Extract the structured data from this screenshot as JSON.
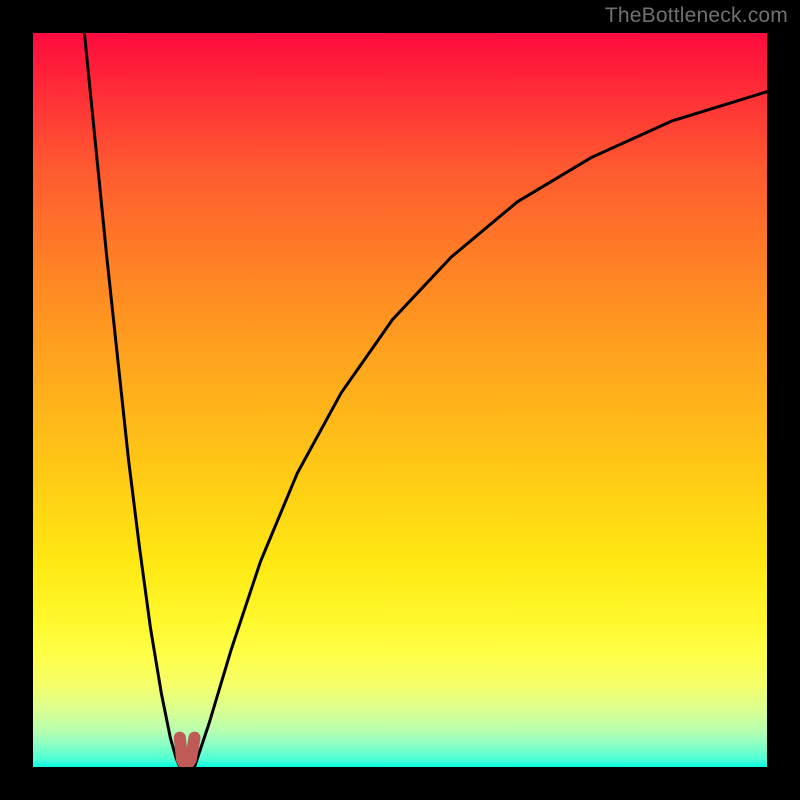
{
  "watermark": "TheBottleneck.com",
  "chart_data": {
    "type": "line",
    "title": "",
    "xlabel": "",
    "ylabel": "",
    "xlim": [
      0,
      1
    ],
    "ylim": [
      0,
      1
    ],
    "series": [
      {
        "name": "left-branch",
        "x": [
          0.07,
          0.085,
          0.1,
          0.115,
          0.13,
          0.145,
          0.16,
          0.175,
          0.187,
          0.195,
          0.2
        ],
        "y": [
          1.0,
          0.85,
          0.7,
          0.56,
          0.42,
          0.3,
          0.19,
          0.1,
          0.04,
          0.012,
          0.0
        ]
      },
      {
        "name": "right-branch",
        "x": [
          0.22,
          0.24,
          0.27,
          0.31,
          0.36,
          0.42,
          0.49,
          0.57,
          0.66,
          0.76,
          0.87,
          1.0
        ],
        "y": [
          0.0,
          0.06,
          0.16,
          0.28,
          0.4,
          0.51,
          0.61,
          0.695,
          0.77,
          0.83,
          0.88,
          0.92
        ]
      },
      {
        "name": "min-marker",
        "x": [
          0.2,
          0.203,
          0.208,
          0.215,
          0.22
        ],
        "y": [
          0.04,
          0.01,
          0.0,
          0.01,
          0.04
        ]
      }
    ],
    "gradient_stops": [
      {
        "pos": 0.0,
        "color": "#ff0b3e"
      },
      {
        "pos": 0.18,
        "color": "#ff5830"
      },
      {
        "pos": 0.46,
        "color": "#ffa81d"
      },
      {
        "pos": 0.72,
        "color": "#ffe813"
      },
      {
        "pos": 0.89,
        "color": "#f4ff6a"
      },
      {
        "pos": 1.0,
        "color": "#06ffe1"
      }
    ],
    "marker_color": "#c05a56"
  }
}
